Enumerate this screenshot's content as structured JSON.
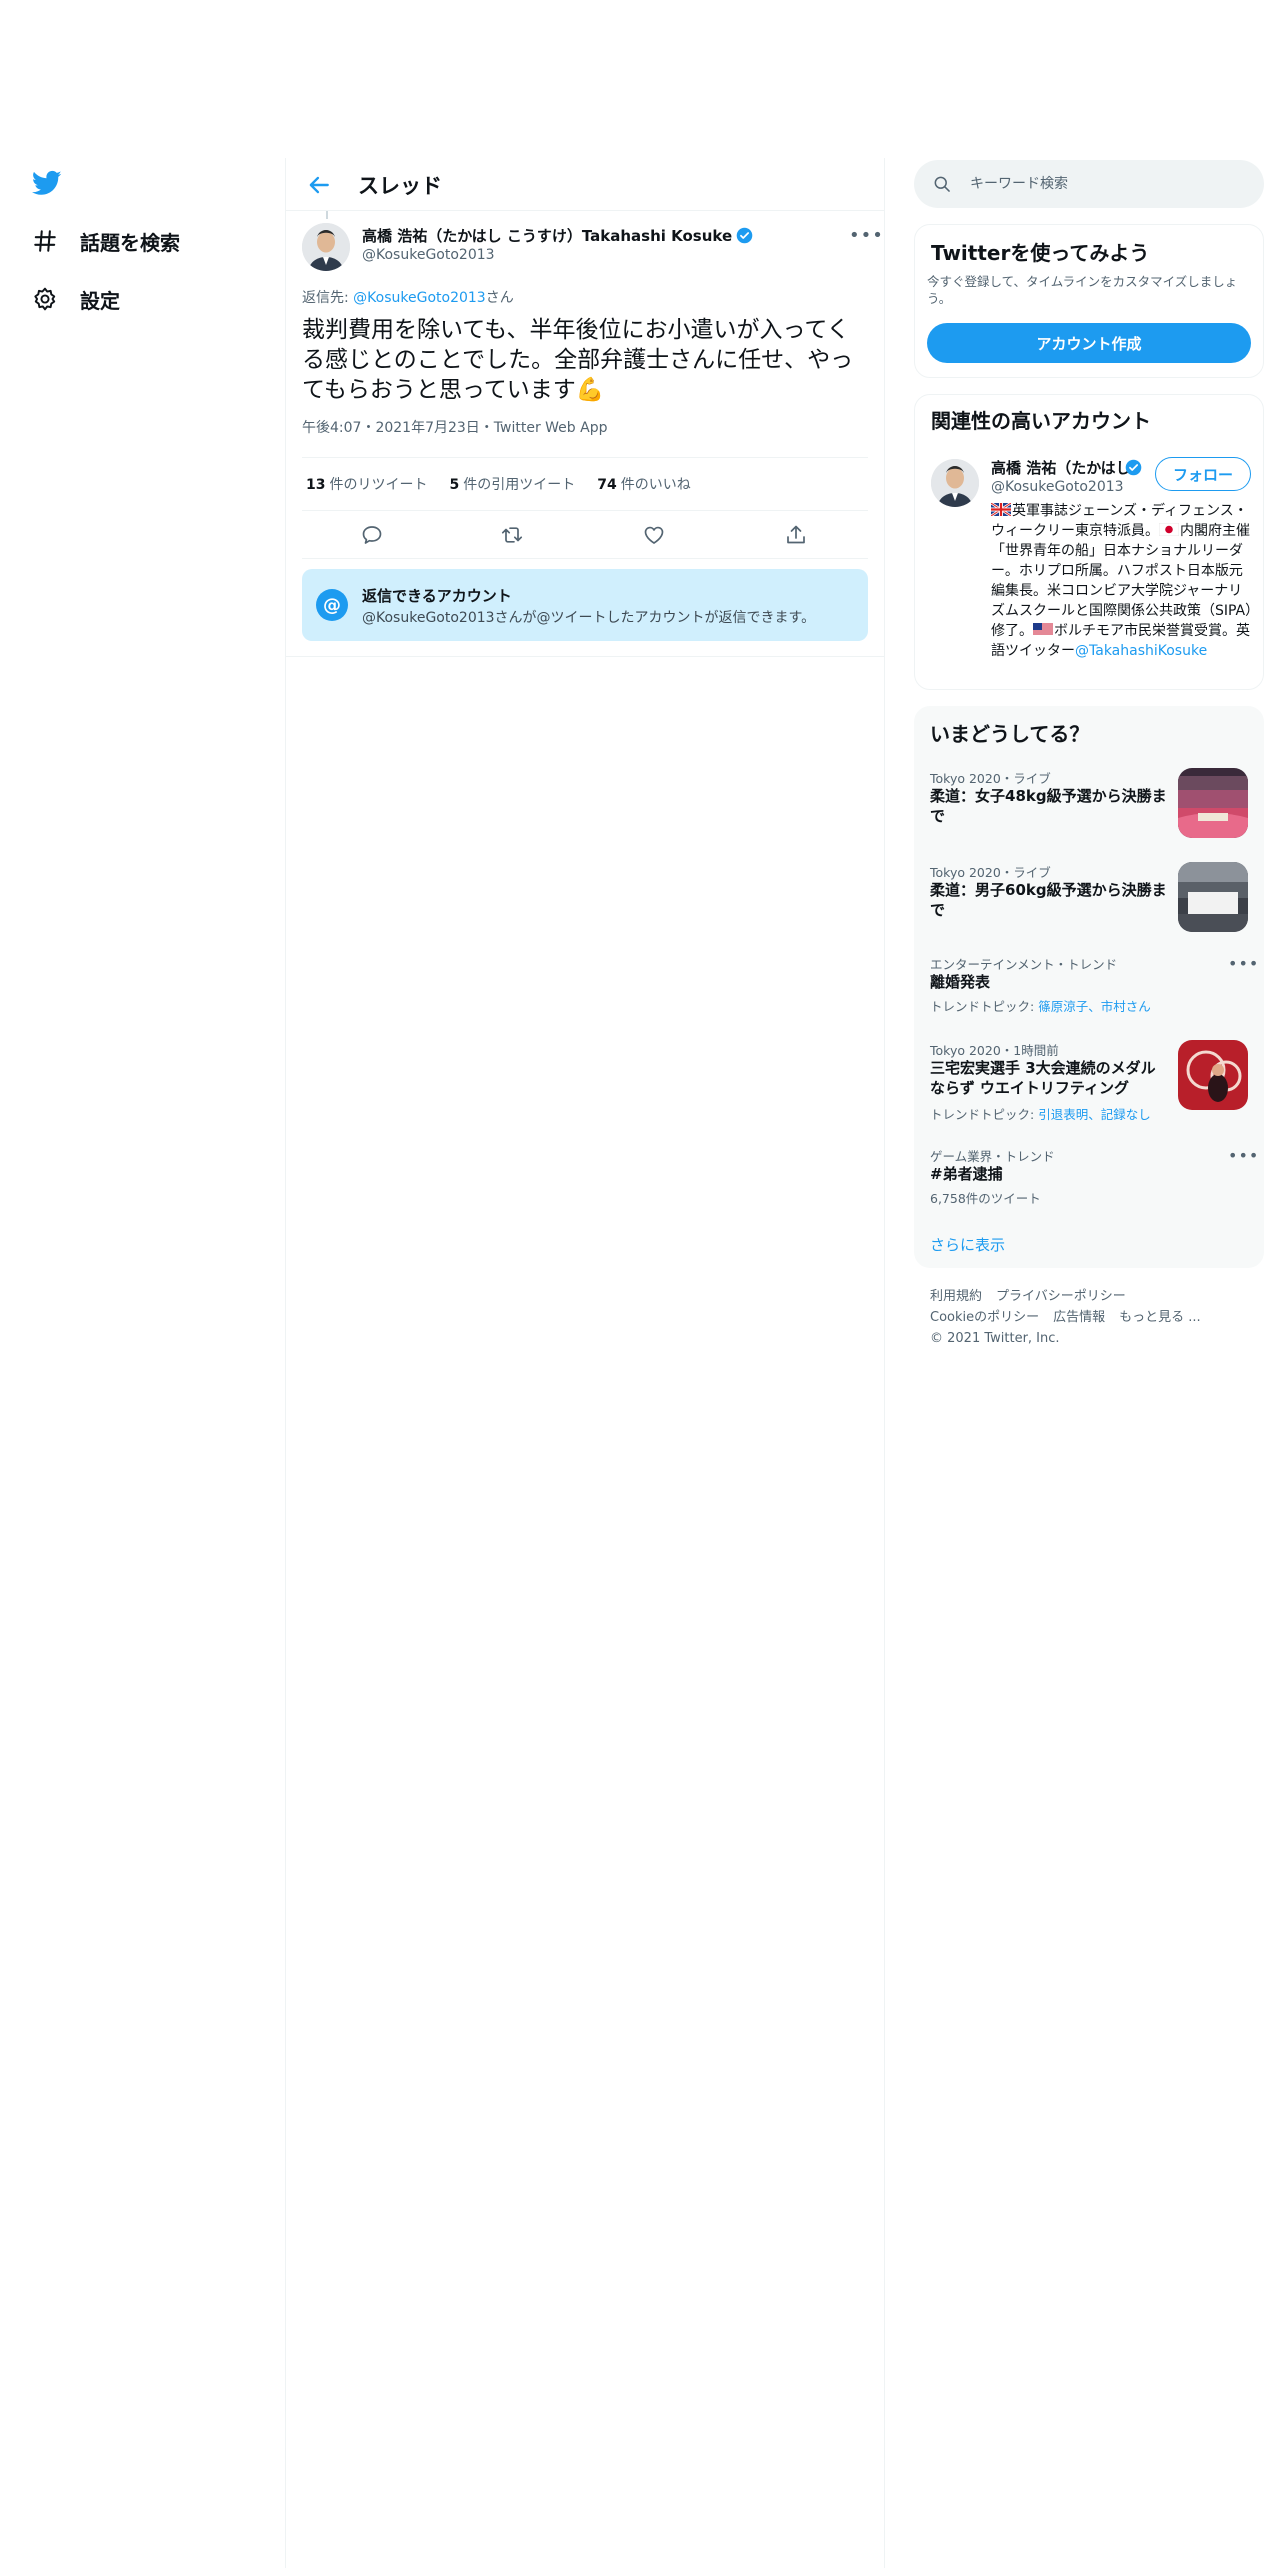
{
  "nav": {
    "items": [
      {
        "label": "話題を検索",
        "icon": "hashtag-icon"
      },
      {
        "label": "設定",
        "icon": "gear-icon"
      }
    ]
  },
  "header": {
    "title": "スレッド"
  },
  "tweet": {
    "author_name": "高橋 浩祐（たかはし こうすけ）Takahashi Kosuke",
    "author_handle": "@KosukeGoto2013",
    "reply_prefix": "返信先: ",
    "reply_to": "@KosukeGoto2013",
    "reply_suffix": "さん",
    "text": "裁判費用を除いても、半年後位にお小遣いが入ってくる感じとのことでした。全部弁護士さんに任せ、やってもらおうと思っています💪",
    "meta": "午後4:07・2021年7月23日・Twitter Web App",
    "stats": [
      {
        "count": "13",
        "label": "件のリツイート"
      },
      {
        "count": "5",
        "label": "件の引用ツイート"
      },
      {
        "count": "74",
        "label": "件のいいね"
      }
    ],
    "reply_box": {
      "title": "返信できるアカウント",
      "text": "@KosukeGoto2013さんが@ツイートしたアカウントが返信できます。"
    }
  },
  "search": {
    "placeholder": "キーワード検索"
  },
  "signup": {
    "title": "Twitterを使ってみよう",
    "subtitle": "今すぐ登録して、タイムラインをカスタマイズしましょう。",
    "button": "アカウント作成"
  },
  "related": {
    "title": "関連性の高いアカウント",
    "name": "高橋 浩祐（たかはし",
    "handle": "@KosukeGoto2013",
    "follow": "フォロー",
    "bio_1": "英軍事誌ジェーンズ・ディフェンス・ウィークリー東京特派員。",
    "bio_2": "内閣府主催「世界青年の船」日本ナショナルリーダー。ホリプロ所属。ハフポスト日本版元編集長。米コロンビア大学院ジャーナリズムスクールと国際関係公共政策（SIPA）修了。",
    "bio_3": "ボルチモア市民栄誉賞受賞。英語ツイッター",
    "bio_mention": "@TakahashiKosuke"
  },
  "trends": {
    "title": "いまどうしてる？",
    "items": [
      {
        "category": "Tokyo 2020・ライブ",
        "title": "柔道：女子48kg級予選から決勝まで"
      },
      {
        "category": "Tokyo 2020・ライブ",
        "title": "柔道：男子60kg級予選から決勝まで"
      },
      {
        "category": "エンターテインメント・トレンド",
        "title": "離婚発表",
        "sub_prefix": "トレンドトピック: ",
        "sub_links": "篠原涼子、市村さん"
      },
      {
        "category": "Tokyo 2020・1時間前",
        "title": "三宅宏実選手 3大会連続のメダルならず ウエイトリフティング",
        "sub_prefix": "トレンドトピック: ",
        "sub_links": "引退表明、記録なし"
      },
      {
        "category": "ゲーム業界・トレンド",
        "title": "#弟者逮捕",
        "sub": "6,758件のツイート"
      }
    ],
    "show_more": "さらに表示"
  },
  "footer": {
    "links": [
      "利用規約",
      "プライバシーポリシー",
      "Cookieのポリシー",
      "広告情報",
      "もっと見る ..."
    ],
    "copyright": "© 2021 Twitter, Inc."
  },
  "colors": {
    "accent": "#1d9bf0",
    "text": "#0f1419",
    "muted": "#536471",
    "reply_box_bg": "#d0effd"
  }
}
